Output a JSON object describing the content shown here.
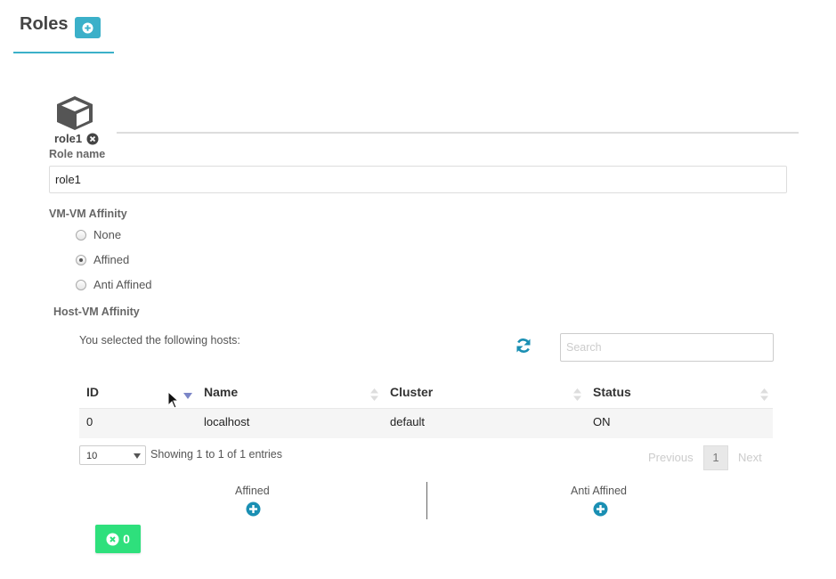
{
  "header": {
    "title": "Roles",
    "add_button_icon": "plus-circle-icon"
  },
  "role_tab": {
    "label": "role1",
    "icon": "cube-icon",
    "close_icon": "close-circle-icon"
  },
  "role_form": {
    "role_name_label": "Role name",
    "role_name_value": "role1",
    "vm_affinity_label": "VM-VM Affinity",
    "vm_affinity_options": [
      {
        "label": "None",
        "checked": false
      },
      {
        "label": "Affined",
        "checked": true
      },
      {
        "label": "Anti Affined",
        "checked": false
      }
    ],
    "host_affinity_label": "Host-VM Affinity"
  },
  "hosts": {
    "intro_text": "You selected the following hosts:",
    "refresh_icon": "refresh-icon",
    "search_placeholder": "Search",
    "columns": [
      "ID",
      "Name",
      "Cluster",
      "Status"
    ],
    "rows": [
      {
        "id": "0",
        "name": "localhost",
        "cluster": "default",
        "status": "ON"
      }
    ],
    "page_size": "10",
    "entries_info": "Showing 1 to 1 of 1 entries",
    "pagination": {
      "previous": "Previous",
      "current": "1",
      "next": "Next"
    }
  },
  "affinity_groups": {
    "affined_label": "Affined",
    "anti_affined_label": "Anti Affined"
  },
  "footer": {
    "count": "0",
    "icon": "close-circle-icon"
  },
  "colors": {
    "accent": "#3bb0c9",
    "success": "#2ee07c",
    "icon_blue": "#1a8fb3"
  }
}
